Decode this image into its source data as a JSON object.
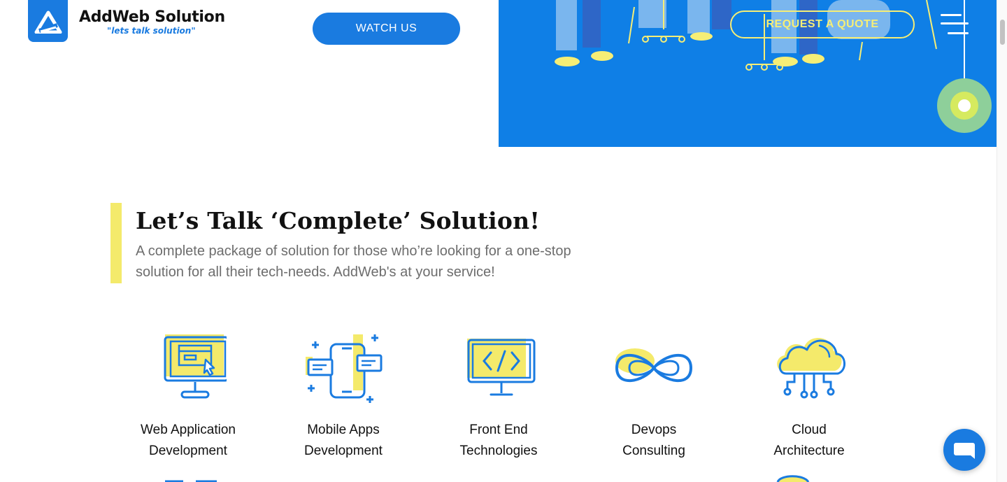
{
  "header": {
    "logo_name": "AddWeb Solution",
    "logo_tagline": "\"lets talk solution\"",
    "watch_label": "WATCH US"
  },
  "hero": {
    "quote_label": "REQUEST A QUOTE"
  },
  "section": {
    "title": "Let’s Talk ‘Complete’ Solution!",
    "subtitle": "A complete package of solution for those who’re looking for a one-stop solution for all their tech-needs. AddWeb's at your service!"
  },
  "services": [
    {
      "line1": "Web Application",
      "line2": "Development",
      "icon": "web-app-icon"
    },
    {
      "line1": "Mobile Apps",
      "line2": "Development",
      "icon": "mobile-apps-icon"
    },
    {
      "line1": "Front End",
      "line2": "Technologies",
      "icon": "code-monitor-icon"
    },
    {
      "line1": "Devops",
      "line2": "Consulting",
      "icon": "infinity-icon"
    },
    {
      "line1": "Cloud",
      "line2": "Architecture",
      "icon": "cloud-icon"
    }
  ],
  "colors": {
    "brand_blue": "#1a7be0",
    "accent_yellow": "#f4ea6b",
    "text_gray": "#6d6d6d"
  }
}
